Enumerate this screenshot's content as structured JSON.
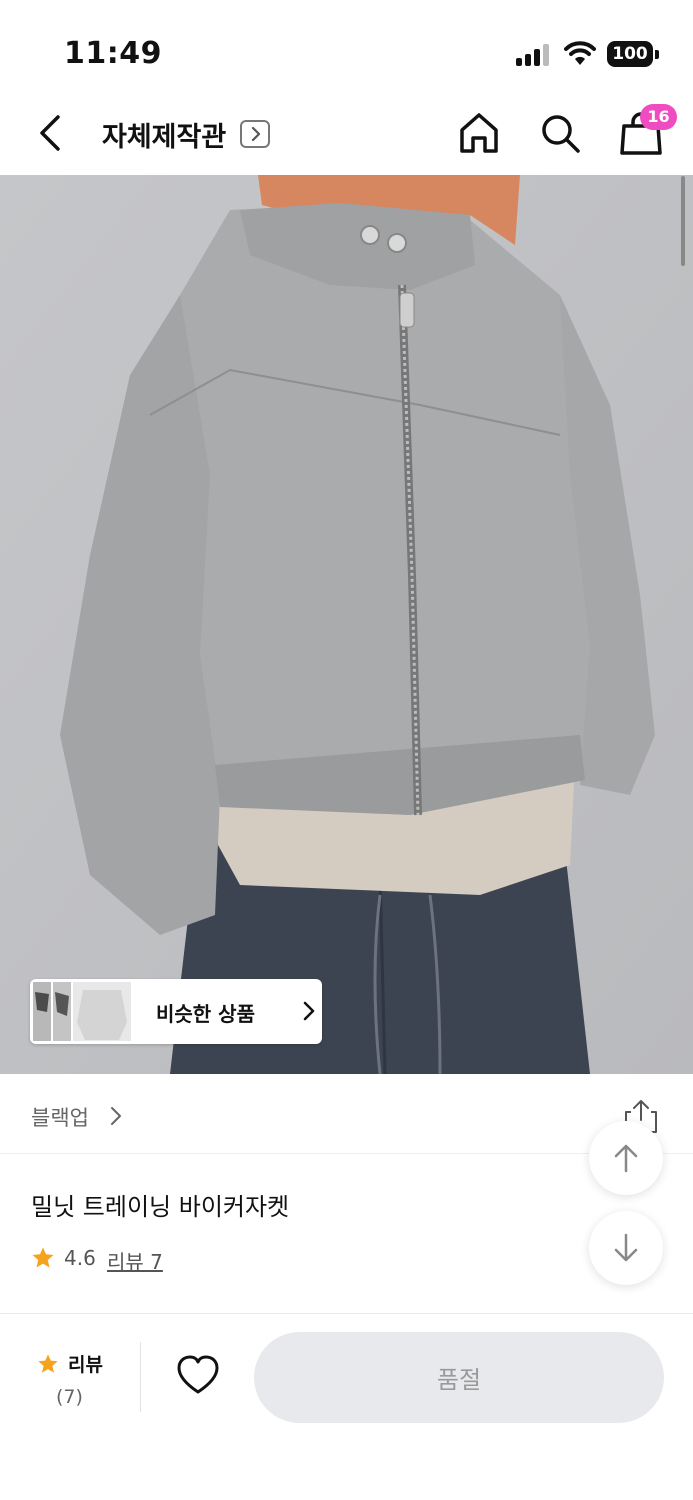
{
  "status_bar": {
    "time": "11:49",
    "battery": "100",
    "signal_icon": "cellular-signal-icon",
    "wifi_icon": "wifi-icon"
  },
  "header": {
    "back_icon": "chevron-left-icon",
    "store_title": "자체제작관",
    "store_link_icon": "chevron-right-box-icon",
    "home_icon": "home-icon",
    "search_icon": "search-icon",
    "cart_icon": "shopping-bag-icon",
    "cart_badge": "16",
    "badge_color": "#f04cc1"
  },
  "product_image": {
    "similar_products_label": "비슷한 상품",
    "similar_products_icon": "chevron-right-icon"
  },
  "brand": {
    "name": "블랙업",
    "share_icon": "share-icon"
  },
  "floating": {
    "up_icon": "arrow-up-icon",
    "down_icon": "arrow-down-icon"
  },
  "product": {
    "title": "밀닛 트레이닝 바이커자켓",
    "rating": "4.6",
    "review_link": "리뷰 7",
    "star_color": "#f7a21b"
  },
  "bottom_bar": {
    "review_label": "리뷰",
    "review_count": "(7)",
    "like_icon": "heart-outline-icon",
    "soldout_label": "품절"
  }
}
